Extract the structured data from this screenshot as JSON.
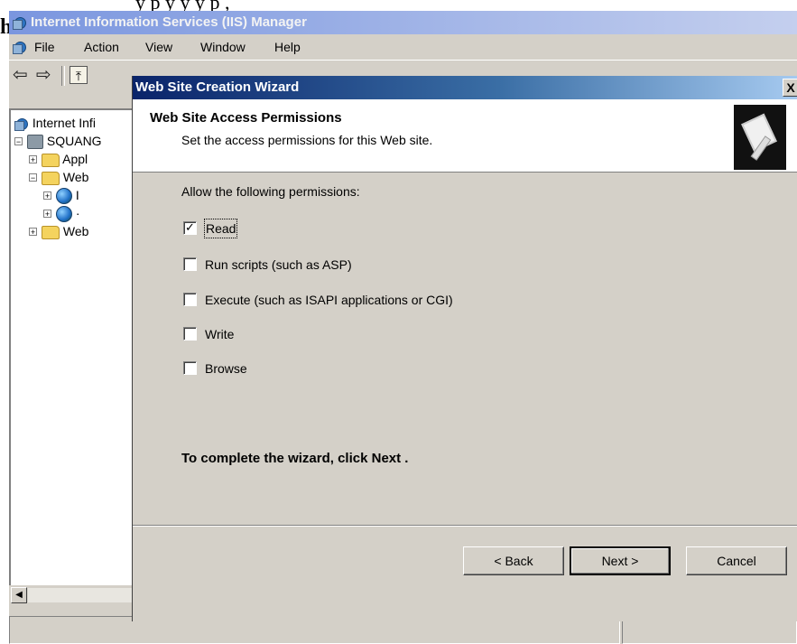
{
  "background_doc": {
    "top_text": "y   p y   y y  p          ,",
    "left_glyph": "h"
  },
  "main_window": {
    "title": "Internet Information Services (IIS) Manager",
    "menu": {
      "file": "File",
      "action": "Action",
      "view": "View",
      "window": "Window",
      "help": "Help"
    },
    "toolbar": {
      "back_glyph": "⇦",
      "forward_glyph": "⇨",
      "up_glyph": "⤒"
    },
    "tree": {
      "root": "Internet Infi",
      "server": "SQUANG",
      "items": [
        {
          "label": "Appl",
          "icon": "folder-icon",
          "expander": "+"
        },
        {
          "label": "Web",
          "icon": "folder-icon",
          "expander": "−"
        },
        {
          "label": "I",
          "icon": "globe-icon",
          "expander": "+"
        },
        {
          "label": "·",
          "icon": "globe-icon",
          "expander": "+"
        },
        {
          "label": "Web",
          "icon": "folder-icon",
          "expander": "+"
        }
      ]
    }
  },
  "wizard": {
    "title": "Web Site Creation Wizard",
    "close_glyph": "X",
    "heading": "Web Site Access Permissions",
    "subheading": "Set the access permissions for this Web site.",
    "intro": "Allow the following permissions:",
    "permissions": [
      {
        "label": "Read",
        "checked": true
      },
      {
        "label": "Run scripts (such as ASP)",
        "checked": false
      },
      {
        "label": "Execute (such as ISAPI applications or CGI)",
        "checked": false
      },
      {
        "label": "Write",
        "checked": false
      },
      {
        "label": "Browse",
        "checked": false
      }
    ],
    "finish_text": "To complete the wizard, click Next .",
    "buttons": {
      "back": "< Back",
      "next": "Next >",
      "cancel": "Cancel"
    }
  }
}
